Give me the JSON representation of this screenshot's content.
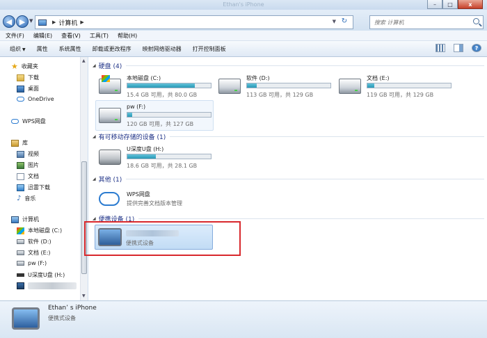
{
  "window": {
    "title": "Ethan's iPhone",
    "controls": {
      "minimize": "–",
      "maximize": "□",
      "close": "x"
    }
  },
  "address": {
    "nav_back": "◀",
    "nav_forward": "▶",
    "history_dropdown": "▼",
    "location": "计算机",
    "separator": "▶",
    "dropdown": "▼",
    "refresh": "↻",
    "search_placeholder": "搜索 计算机"
  },
  "menu": [
    "文件(F)",
    "编辑(E)",
    "查看(V)",
    "工具(T)",
    "帮助(H)"
  ],
  "toolbar": {
    "organize": "组织",
    "organize_arrow": "▼",
    "properties": "属性",
    "system_properties": "系统属性",
    "uninstall": "卸载或更改程序",
    "map_drive": "映射网络驱动器",
    "control_panel": "打开控制面板",
    "help_glyph": "?"
  },
  "nav": {
    "favorites": "收藏夹",
    "downloads": "下载",
    "desktop": "桌面",
    "onedrive": "OneDrive",
    "wps": "WPS网盘",
    "libraries": "库",
    "videos": "视频",
    "pictures": "图片",
    "documents": "文档",
    "xunlei": "迅雷下载",
    "music": "音乐",
    "computer": "计算机",
    "drive_c": "本地磁盘 (C:)",
    "drive_d": "软件 (D:)",
    "drive_e": "文档 (E:)",
    "drive_f": "pw (F:)",
    "drive_h": "U深度U盘 (H:)"
  },
  "scrollbar": {
    "up": "▲",
    "down": "▼"
  },
  "groups": {
    "hard_disks": "硬盘 (4)",
    "removable": "有可移动存储的设备 (1)",
    "other": "其他 (1)",
    "portable": "便携设备 (1)",
    "arrow": "◢"
  },
  "drives": {
    "c": {
      "name": "本地磁盘 (C:)",
      "info": "15.4 GB 可用，共 80.0 GB",
      "used_fraction": 0.81
    },
    "d": {
      "name": "软件 (D:)",
      "info": "113 GB 可用，共 129 GB",
      "used_fraction": 0.12
    },
    "e": {
      "name": "文档 (E:)",
      "info": "119 GB 可用，共 129 GB",
      "used_fraction": 0.08
    },
    "f": {
      "name": "pw (F:)",
      "info": "120 GB 可用，共 127 GB",
      "used_fraction": 0.06
    },
    "h": {
      "name": "U深度U盘 (H:)",
      "info": "18.6 GB 可用，共 28.1 GB",
      "used_fraction": 0.34
    }
  },
  "wps_item": {
    "name": "WPS网盘",
    "desc": "提供完善文档版本管理"
  },
  "portable_item": {
    "type": "便携式设备"
  },
  "details": {
    "name": "Ethan’ s iPhone",
    "type": "便携式设备"
  },
  "colors": {
    "highlight": "#d8282c",
    "bar_fill": "#2798b6",
    "group_header": "#1e3287"
  }
}
